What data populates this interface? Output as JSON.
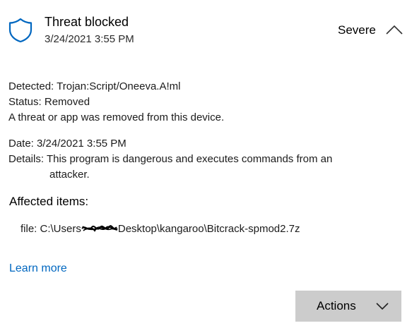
{
  "header": {
    "title": "Threat blocked",
    "date": "3/24/2021 3:55 PM",
    "severity": "Severe",
    "icon": "shield-icon",
    "accent_color": "#0067c0"
  },
  "details": {
    "detected_label": "Detected:",
    "detected_value": "Trojan:Script/Oneeva.A!ml",
    "status_label": "Status:",
    "status_value": "Removed",
    "removed_message": "A threat or app was removed from this device.",
    "date_label": "Date:",
    "date_value": "3/24/2021 3:55 PM",
    "details_label": "Details:",
    "details_value_line1": "This program is dangerous and executes commands from an",
    "details_value_line2": "attacker."
  },
  "affected": {
    "heading": "Affected items:",
    "file_prefix": "file: C:\\Users",
    "file_suffix": "Desktop\\kangaroo\\Bitcrack-spmod2.7z"
  },
  "links": {
    "learn_more": "Learn more"
  },
  "actions": {
    "label": "Actions",
    "background": "#cccccc"
  }
}
